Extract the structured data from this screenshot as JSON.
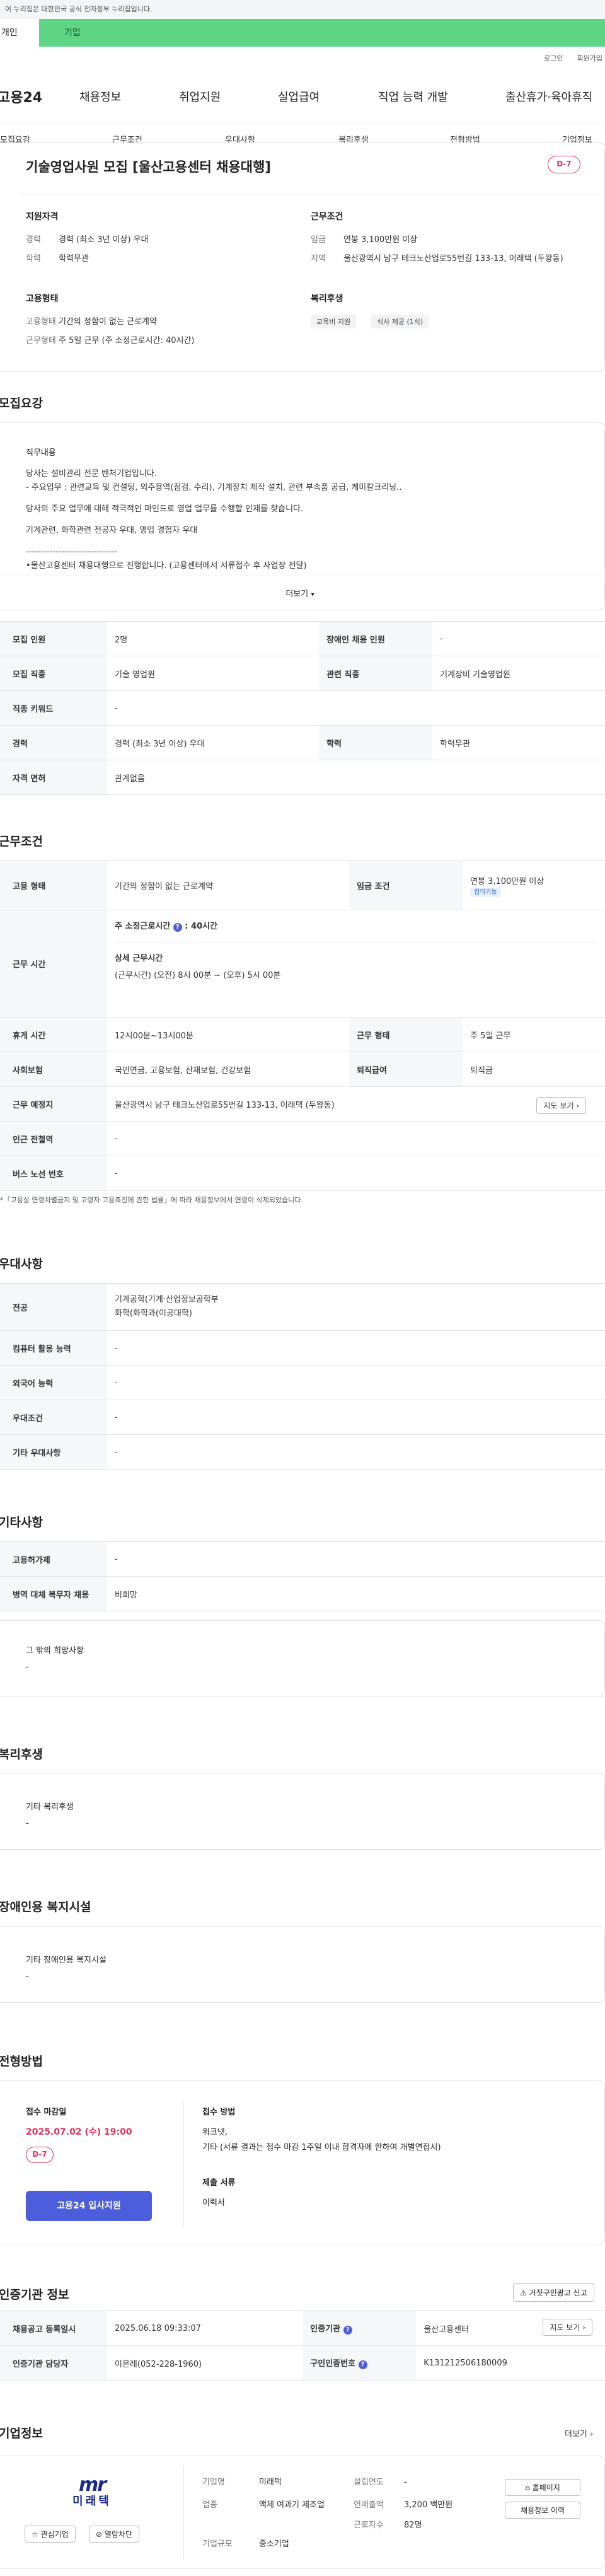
{
  "gov_banner": "이 누리집은 대한민국 공식 전자정부 누리집입니다.",
  "tabs": [
    "개인",
    "기업"
  ],
  "util": [
    "로그인",
    "회원가입"
  ],
  "logo": "고용24",
  "gnb": [
    "채용정보",
    "취업지원",
    "실업급여",
    "직업 능력 개발",
    "출산휴가·육아휴직"
  ],
  "subnav": [
    "모집요강",
    "근무조건",
    "우대사항",
    "복리후생",
    "전형방법",
    "기업정보"
  ],
  "job": {
    "title": "기술영업사원 모집 [울산고용센터 채용대행]",
    "dday": "D-7",
    "qual_title": "지원자격",
    "cond_title": "근무조건",
    "career_k": "경력",
    "career_v": "경력 (최소 3년 이상) 우대",
    "edu_k": "학력",
    "edu_v": "학력무관",
    "pay_k": "임금",
    "pay_v": "연봉 3,100만원 이상",
    "area_k": "지역",
    "area_v": "울산광역시 남구 테크노산업로55번길 133-13, 이래택 (두왕동)",
    "emp_title": "고용형태",
    "welfare_title": "복리후생",
    "emptype_k": "고용형태",
    "emptype_v": "기간의 정함이 없는 근로계약",
    "worktype_k": "근무형태",
    "worktype_v": "주 5일 근무 (주 소정근로시간: 40시간)",
    "chips": [
      "교육비 지원",
      "식사 제공 (1식)"
    ]
  },
  "recruit": {
    "sec": "모집요강",
    "duty_title": "직무내용",
    "lines": [
      "당사는 설비관리 전문 벤처기업입니다.",
      "- 주요업무 : 관련교육 및 컨설팅, 외주용역(점검, 수리), 기계장치 제작 설치, 관련 부속품 공급, 케미칼크리닝..",
      "당사의 주요 업무에 대해 적극적인 마인드로 영업 업무를 수행할 인재를 찾습니다.",
      "기계관련, 화학관련 전공자 우대,  영업 경험자 우대",
      "-------------------------------",
      "•울산고용센터 채용대행으로 진행합니다. (고용센터에서 서류접수 후 사업장 전달)"
    ],
    "more": "더보기",
    "rows": [
      [
        "모집 인원",
        "2명",
        "장애인 채용 인원",
        "-"
      ],
      [
        "모집 직종",
        "기술 영업원",
        "관련 직종",
        "기계장비 기술영업원"
      ],
      [
        "직종 키워드",
        "-",
        "",
        ""
      ],
      [
        "경력",
        "경력 (최소 3년 이상) 우대",
        "학력",
        "학력무관"
      ],
      [
        "자격 면허",
        "관계없음",
        "",
        ""
      ]
    ]
  },
  "work": {
    "sec": "근무조건",
    "emp_k": "고용 형태",
    "emp_v": "기간의 정함이 없는 근로계약",
    "pay_k": "임금 조건",
    "pay_v": "연봉 3,100만원 이상",
    "pay_badge": "협의가능",
    "time_k": "근무 시간",
    "time_head": "주 소정근로시간",
    "time_val": "40시간",
    "detail_title": "상세 근무시간",
    "detail_val": "(근무시간) (오전) 8시 00분 ~ (오후) 5시 00분",
    "rest_k": "휴게 시간",
    "rest_v": "12시00분~13시00분",
    "form_k": "근무 형태",
    "form_v": "주 5일 근무",
    "ins_k": "사회보험",
    "ins_v": "국민연금, 고용보험, 산재보험, 건강보험",
    "ret_k": "퇴직급여",
    "ret_v": "퇴직금",
    "place_k": "근무 예정지",
    "place_v": "울산광역시 남구 테크노산업로55번길 133-13, 이래택 (두왕동)",
    "map": "지도 보기",
    "sub_k": "인근 전철역",
    "sub_v": "-",
    "bus_k": "버스 노선 번호",
    "bus_v": "-",
    "note": "*「고용상 연령차별금지 및 고령자 고용촉진에 관한 법률」에 따라 채용정보에서 연령이 삭제되었습니다."
  },
  "pref": {
    "sec": "우대사항",
    "rows": [
      [
        "전공",
        "기계공학(기계·산업정보공학부\n화학(화학과(이공대학)"
      ],
      [
        "컴퓨터 활용 능력",
        "-"
      ],
      [
        "외국어 능력",
        "-"
      ],
      [
        "우대조건",
        "-"
      ],
      [
        "기타 우대사항",
        "-"
      ]
    ]
  },
  "etc": {
    "sec": "기타사항",
    "rows": [
      [
        "고용허가제",
        "-"
      ],
      [
        "병역 대체 복무자 채용",
        "비희망"
      ]
    ],
    "other_title": "그 밖의 희망사항",
    "other_v": "-"
  },
  "welfare": {
    "sec": "복리후생",
    "title": "기타 복리후생",
    "v": "-"
  },
  "disabled": {
    "sec": "장애인용 복지시설",
    "title": "기타 장애인용 복지시설",
    "v": "-"
  },
  "selection": {
    "sec": "전형방법",
    "deadline_k": "접수 마감일",
    "deadline_v": "2025.07.02 (수) 19:00",
    "dday": "D-7",
    "apply_btn": "고용24 입사지원",
    "method_k": "접수 방법",
    "method_v1": "워크넷,",
    "method_v2": "기타 (서류 결과는 접수 마감 1주일 이내 합격자에 한하여 개별연접시)",
    "docs_k": "제출 서류",
    "docs_v": "이력서"
  },
  "agency": {
    "sec": "인증기관 정보",
    "report": "거짓구인광고 신고",
    "rows": [
      [
        "채용공고 등록일시",
        "2025.06.18 09:33:07",
        "인증기관",
        "울산고용센터"
      ],
      [
        "인증기관 담당자",
        "이은례(052-228-1960)",
        "구인인증번호",
        "K131212506180009"
      ]
    ],
    "map": "지도 보기"
  },
  "company": {
    "sec": "기업정보",
    "more": "더보기",
    "logo_txt": "미래텍",
    "fav": "관심기업",
    "block": "열람차단",
    "ind_k": "기업명",
    "ind_v": "미래택",
    "biz_k": "업종",
    "biz_v": "액체 여과기 제조업",
    "size_k": "기업규모",
    "size_v": "중소기업",
    "year_k": "설립연도",
    "year_v": "-",
    "sales_k": "연매출액",
    "sales_v": "3,200 백만원",
    "emp_k": "근로자수",
    "emp_v": "82명",
    "home": "홈페이지",
    "info": "채용정보 이력"
  }
}
